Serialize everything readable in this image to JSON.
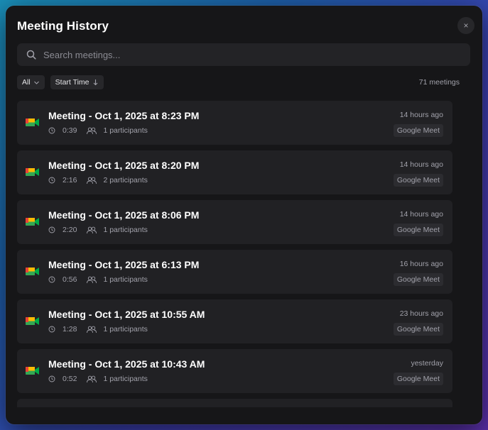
{
  "dialog": {
    "title": "Meeting History",
    "close_label": "×"
  },
  "search": {
    "placeholder": "Search meetings...",
    "value": ""
  },
  "filters": {
    "filter_label": "All",
    "sort_label": "Start Time"
  },
  "summary": {
    "count_text": "71 meetings"
  },
  "meetings": [
    {
      "title": "Meeting - Oct 1, 2025 at 8:23 PM",
      "duration": "0:39",
      "participants": "1 participants",
      "ago": "14 hours ago",
      "platform": "Google Meet"
    },
    {
      "title": "Meeting - Oct 1, 2025 at 8:20 PM",
      "duration": "2:16",
      "participants": "2 participants",
      "ago": "14 hours ago",
      "platform": "Google Meet"
    },
    {
      "title": "Meeting - Oct 1, 2025 at 8:06 PM",
      "duration": "2:20",
      "participants": "1 participants",
      "ago": "14 hours ago",
      "platform": "Google Meet"
    },
    {
      "title": "Meeting - Oct 1, 2025 at 6:13 PM",
      "duration": "0:56",
      "participants": "1 participants",
      "ago": "16 hours ago",
      "platform": "Google Meet"
    },
    {
      "title": "Meeting - Oct 1, 2025 at 10:55 AM",
      "duration": "1:28",
      "participants": "1 participants",
      "ago": "23 hours ago",
      "platform": "Google Meet"
    },
    {
      "title": "Meeting - Oct 1, 2025 at 10:43 AM",
      "duration": "0:52",
      "participants": "1 participants",
      "ago": "yesterday",
      "platform": "Google Meet"
    }
  ],
  "icons": {
    "search": "search-icon",
    "close": "close-icon",
    "chevron": "chevron-down-icon",
    "sort": "arrow-down-icon",
    "clock": "clock-icon",
    "people": "users-icon",
    "meet": "google-meet-icon"
  }
}
